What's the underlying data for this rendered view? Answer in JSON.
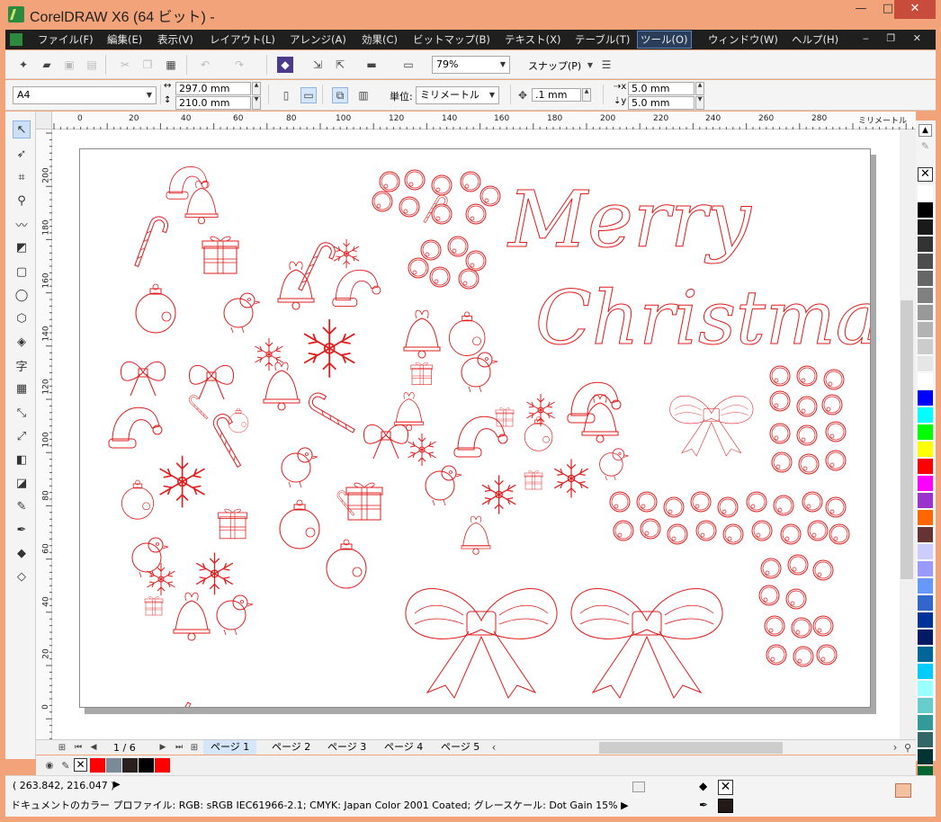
{
  "window": {
    "title": "CorelDRAW X6 (64 ビット) -",
    "minimize": "—",
    "maximize": "□",
    "close": "✕"
  },
  "menu": {
    "items": [
      "ファイル(F)",
      "編集(E)",
      "表示(V)",
      "レイアウト(L)",
      "アレンジ(A)",
      "効果(C)",
      "ビットマップ(B)",
      "テキスト(X)",
      "テーブル(T)",
      "ツール(O)",
      "ウィンドウ(W)",
      "ヘルプ(H)"
    ],
    "active": "ツール(O)",
    "doc_controls": "‒ ❐ ✕"
  },
  "toolbar": {
    "zoom": "79%",
    "snap": "スナップ(P)"
  },
  "property_bar": {
    "paper_size": "A4",
    "width": "297.0 mm",
    "height": "210.0 mm",
    "units_label": "単位:",
    "units": "ミリメートル",
    "nudge": ".1 mm",
    "dup_x": "5.0 mm",
    "dup_y": "5.0 mm"
  },
  "rulers": {
    "h_ticks": [
      "0",
      "20",
      "40",
      "60",
      "80",
      "100",
      "120",
      "140",
      "160",
      "180",
      "200",
      "220",
      "240",
      "260",
      "280"
    ],
    "h_unit": "ミリメートル",
    "v_ticks": [
      "200",
      "180",
      "160",
      "140",
      "120",
      "100",
      "80",
      "60",
      "40",
      "20",
      "0"
    ],
    "v_unit": "ミリメートル"
  },
  "artwork": {
    "line1": "Merry",
    "line2": "Christmas",
    "stroke": "#e21b1b"
  },
  "page_nav": {
    "counter": "1 / 6",
    "pages": [
      "ページ 1",
      "ページ 2",
      "ページ 3",
      "ページ 4",
      "ページ 5"
    ],
    "current_page": "ページ 1"
  },
  "palette": {
    "colors": [
      "#ffffff",
      "#000000",
      "#1a1a1a",
      "#333333",
      "#4d4d4d",
      "#666666",
      "#808080",
      "#999999",
      "#b3b3b3",
      "#cccccc",
      "#e6e6e6",
      "#ffffff",
      "#0000ff",
      "#00ffff",
      "#00ff00",
      "#ffff00",
      "#ff0000",
      "#ff00ff",
      "#9933cc",
      "#ff6600",
      "#663333",
      "#ccccff",
      "#9999ff",
      "#6699ff",
      "#3366cc",
      "#003399",
      "#001a66",
      "#006699",
      "#00ccff",
      "#99ffff",
      "#66cccc",
      "#339999",
      "#336666",
      "#003333",
      "#006633"
    ]
  },
  "doc_palette": {
    "colors": [
      "#ff0000",
      "#7a8a99",
      "#2a1f1f",
      "#000000",
      "#ff0000"
    ]
  },
  "status": {
    "coords": "( 263.842, 216.047 )",
    "arrow": "▶",
    "color_profile": "ドキュメントのカラー プロファイル: RGB: sRGB IEC61966-2.1; CMYK: Japan Color 2001 Coated; グレースケール: Dot Gain 15% ▶"
  }
}
